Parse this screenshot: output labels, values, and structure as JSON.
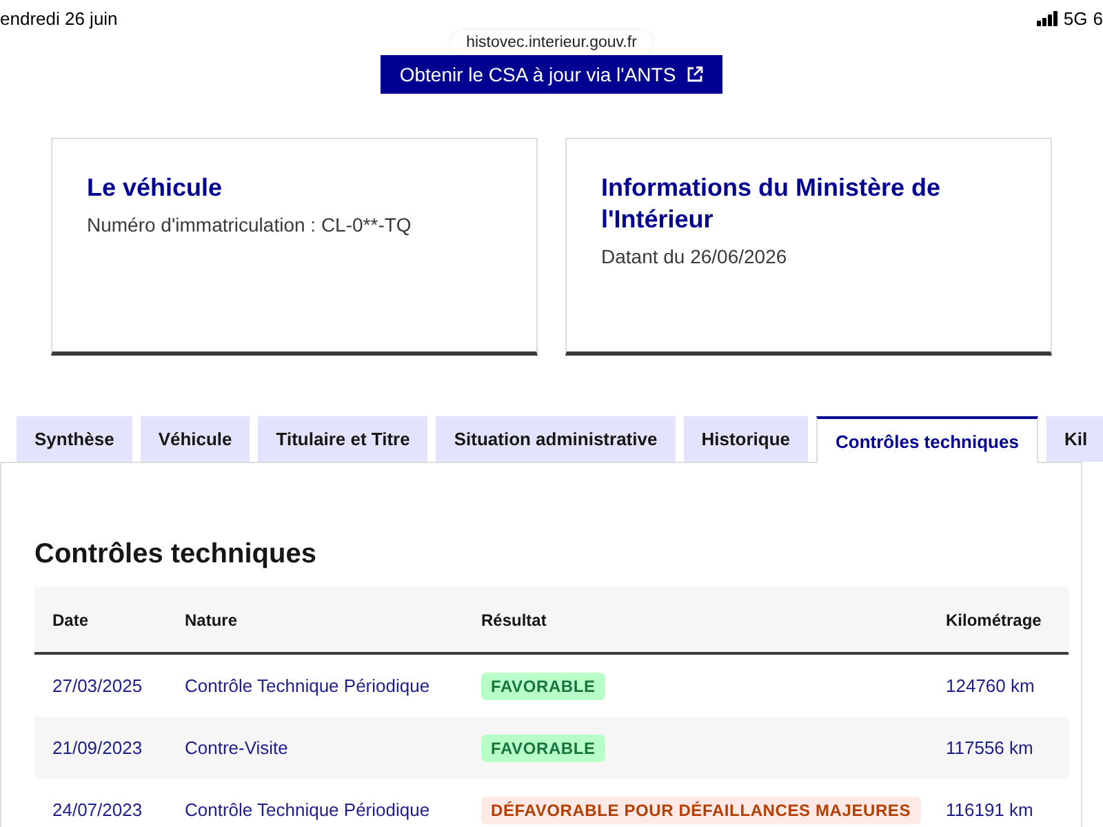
{
  "status_bar": {
    "date": "endredi 26 juin",
    "network": "5G",
    "battery": "6"
  },
  "url_bar": {
    "address": "histovec.interieur.gouv.fr"
  },
  "csa_button": {
    "label": "Obtenir le CSA à jour via l'ANTS"
  },
  "cards": [
    {
      "title": "Le véhicule",
      "text": "Numéro d'immatriculation : CL-0**-TQ"
    },
    {
      "title": "Informations du Ministère de l'Intérieur",
      "text": "Datant du 26/06/2026"
    }
  ],
  "tabs": [
    {
      "label": "Synthèse",
      "selected": false
    },
    {
      "label": "Véhicule",
      "selected": false
    },
    {
      "label": "Titulaire et Titre",
      "selected": false
    },
    {
      "label": "Situation administrative",
      "selected": false
    },
    {
      "label": "Historique",
      "selected": false
    },
    {
      "label": "Contrôles techniques",
      "selected": true
    },
    {
      "label": "Kil",
      "selected": false
    }
  ],
  "panel": {
    "heading": "Contrôles techniques",
    "table": {
      "columns": [
        "Date",
        "Nature",
        "Résultat",
        "Kilométrage"
      ],
      "rows": [
        {
          "date": "27/03/2025",
          "nature": "Contrôle Technique Périodique",
          "result": {
            "label": "FAVORABLE",
            "kind": "success"
          },
          "mileage": "124760 km"
        },
        {
          "date": "21/09/2023",
          "nature": "Contre-Visite",
          "result": {
            "label": "FAVORABLE",
            "kind": "success"
          },
          "mileage": "117556 km"
        },
        {
          "date": "24/07/2023",
          "nature": "Contrôle Technique Périodique",
          "result": {
            "label": "DÉFAVORABLE POUR DÉFAILLANCES MAJEURES",
            "kind": "error"
          },
          "mileage": "116191 km"
        }
      ]
    }
  }
}
